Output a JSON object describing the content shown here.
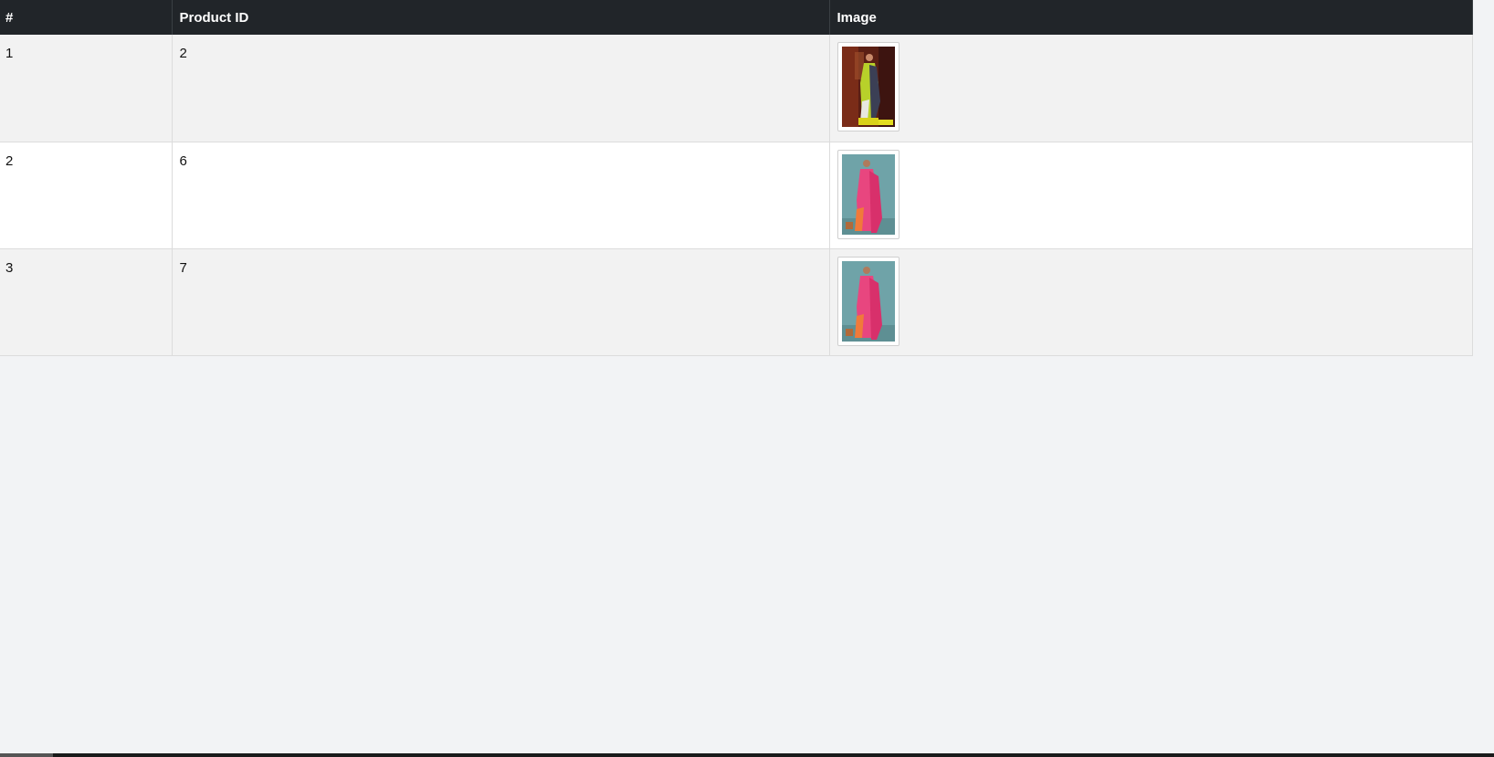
{
  "table": {
    "headers": {
      "index": "#",
      "product_id": "Product ID",
      "image": "Image"
    },
    "rows": [
      {
        "index": "1",
        "product_id": "2",
        "image": "saree-thumbnail-green"
      },
      {
        "index": "2",
        "product_id": "6",
        "image": "saree-thumbnail-pink"
      },
      {
        "index": "3",
        "product_id": "7",
        "image": "saree-thumbnail-pink"
      }
    ]
  },
  "colors": {
    "header_bg": "#212529",
    "header_text": "#ffffff",
    "row_odd_bg": "#f2f2f2",
    "row_even_bg": "#ffffff",
    "page_bg": "#f2f3f5"
  }
}
